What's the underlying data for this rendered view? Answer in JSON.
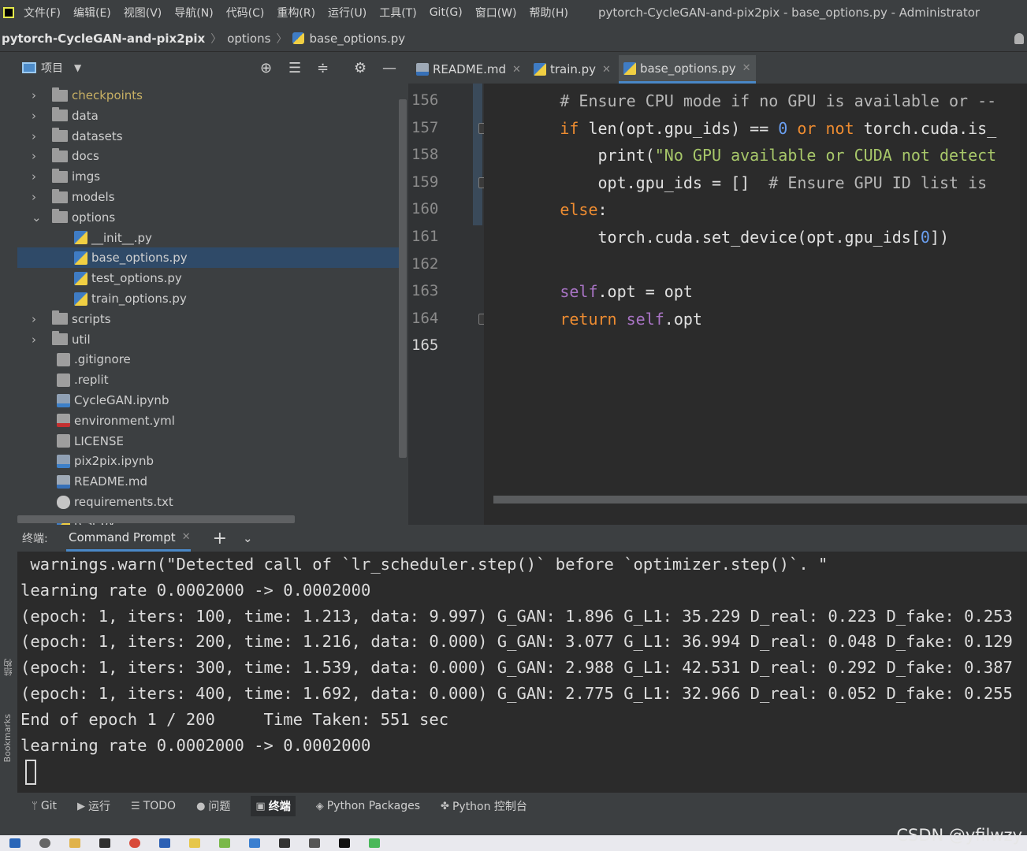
{
  "menubar": {
    "items": [
      "文件(F)",
      "编辑(E)",
      "视图(V)",
      "导航(N)",
      "代码(C)",
      "重构(R)",
      "运行(U)",
      "工具(T)",
      "Git(G)",
      "窗口(W)",
      "帮助(H)"
    ],
    "window_title": "pytorch-CycleGAN-and-pix2pix - base_options.py - Administrator"
  },
  "breadcrumb": {
    "project": "pytorch-CycleGAN-and-pix2pix",
    "folder": "options",
    "file": "base_options.py"
  },
  "project_panel": {
    "title": "项目",
    "tree": [
      {
        "name": "checkpoints",
        "type": "folder",
        "state": "collapsed",
        "depth": 0
      },
      {
        "name": "data",
        "type": "folder",
        "state": "collapsed",
        "depth": 0
      },
      {
        "name": "datasets",
        "type": "folder",
        "state": "collapsed",
        "depth": 0
      },
      {
        "name": "docs",
        "type": "folder",
        "state": "collapsed",
        "depth": 0
      },
      {
        "name": "imgs",
        "type": "folder",
        "state": "collapsed",
        "depth": 0
      },
      {
        "name": "models",
        "type": "folder",
        "state": "collapsed",
        "depth": 0
      },
      {
        "name": "options",
        "type": "folder",
        "state": "expanded",
        "depth": 0
      },
      {
        "name": "__init__.py",
        "type": "py",
        "depth": 1
      },
      {
        "name": "base_options.py",
        "type": "py",
        "depth": 1,
        "selected": true
      },
      {
        "name": "test_options.py",
        "type": "py",
        "depth": 1
      },
      {
        "name": "train_options.py",
        "type": "py",
        "depth": 1
      },
      {
        "name": "scripts",
        "type": "folder",
        "state": "collapsed",
        "depth": 0
      },
      {
        "name": "util",
        "type": "folder",
        "state": "collapsed",
        "depth": 0
      },
      {
        "name": ".gitignore",
        "type": "doc",
        "depth": 0
      },
      {
        "name": ".replit",
        "type": "doc",
        "depth": 0
      },
      {
        "name": "CycleGAN.ipynb",
        "type": "nb",
        "depth": 0
      },
      {
        "name": "environment.yml",
        "type": "yml",
        "depth": 0
      },
      {
        "name": "LICENSE",
        "type": "doc",
        "depth": 0
      },
      {
        "name": "pix2pix.ipynb",
        "type": "nb",
        "depth": 0
      },
      {
        "name": "README.md",
        "type": "md",
        "depth": 0
      },
      {
        "name": "requirements.txt",
        "type": "txt",
        "depth": 0
      },
      {
        "name": "test.py",
        "type": "py",
        "depth": 0
      }
    ],
    "folder_highlight_color": "#c8b064"
  },
  "editor": {
    "tabs": [
      {
        "label": "README.md",
        "icon": "markdown-file-icon"
      },
      {
        "label": "train.py",
        "icon": "python-file-icon"
      },
      {
        "label": "base_options.py",
        "icon": "python-file-icon",
        "active": true
      }
    ],
    "line_numbers": [
      "156",
      "157",
      "158",
      "159",
      "160",
      "161",
      "162",
      "163",
      "164",
      "165"
    ],
    "current_line": "165",
    "lines": [
      [
        [
          "cm",
          "        # Ensure CPU mode if no GPU is available or --"
        ]
      ],
      [
        [
          "kw",
          "        if "
        ],
        [
          "tx",
          "len(opt.gpu_ids) == "
        ],
        [
          "nm",
          "0"
        ],
        [
          "kw",
          " or not "
        ],
        [
          "tx",
          "torch.cuda.is_"
        ]
      ],
      [
        [
          "tx",
          "            print("
        ],
        [
          "st",
          "\"No GPU available or CUDA not detect"
        ]
      ],
      [
        [
          "tx",
          "            opt.gpu_ids = []  "
        ],
        [
          "cm",
          "# Ensure GPU ID list is"
        ]
      ],
      [
        [
          "kw",
          "        else"
        ],
        [
          "tx",
          ":"
        ]
      ],
      [
        [
          "tx",
          "            torch.cuda.set_device(opt.gpu_ids["
        ],
        [
          "nm",
          "0"
        ],
        [
          "tx",
          "])"
        ]
      ],
      [],
      [
        [
          "sf",
          "        self"
        ],
        [
          "tx",
          ".opt = opt"
        ]
      ],
      [
        [
          "kw",
          "        return "
        ],
        [
          "sf",
          "self"
        ],
        [
          "tx",
          ".opt"
        ]
      ],
      []
    ]
  },
  "terminal": {
    "label": "终端:",
    "tab": "Command Prompt",
    "lines": [
      " warnings.warn(\"Detected call of `lr_scheduler.step()` before `optimizer.step()`. \"",
      "learning rate 0.0002000 -> 0.0002000",
      "(epoch: 1, iters: 100, time: 1.213, data: 9.997) G_GAN: 1.896 G_L1: 35.229 D_real: 0.223 D_fake: 0.253",
      "(epoch: 1, iters: 200, time: 1.216, data: 0.000) G_GAN: 3.077 G_L1: 36.994 D_real: 0.048 D_fake: 0.129",
      "(epoch: 1, iters: 300, time: 1.539, data: 0.000) G_GAN: 2.988 G_L1: 42.531 D_real: 0.292 D_fake: 0.387",
      "(epoch: 1, iters: 400, time: 1.692, data: 0.000) G_GAN: 2.775 G_L1: 32.966 D_real: 0.052 D_fake: 0.255",
      "End of epoch 1 / 200 \t Time Taken: 551 sec",
      "learning rate 0.0002000 -> 0.0002000"
    ]
  },
  "left_strip": {
    "labels": [
      "结构",
      "Bookmarks"
    ]
  },
  "bottom_toolbar": {
    "items": [
      {
        "label": "Git",
        "icon": "git-branch-icon"
      },
      {
        "label": "运行",
        "icon": "run-icon"
      },
      {
        "label": "TODO",
        "icon": "list-icon"
      },
      {
        "label": "问题",
        "icon": "info-icon"
      },
      {
        "label": "终端",
        "icon": "terminal-icon",
        "active": true
      },
      {
        "label": "Python Packages",
        "icon": "packages-icon"
      },
      {
        "label": "Python 控制台",
        "icon": "python-console-icon"
      }
    ]
  },
  "watermark": "CSDN @yfilwzy"
}
